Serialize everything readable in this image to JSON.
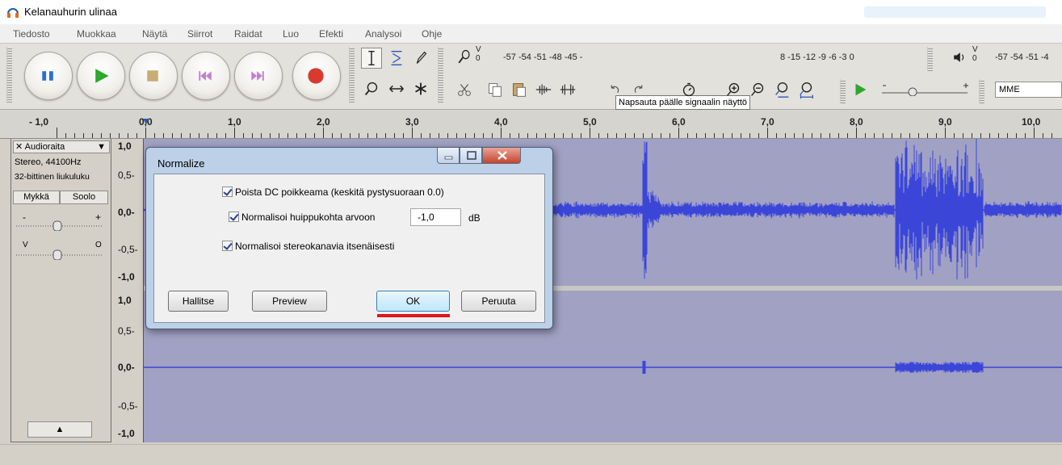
{
  "window": {
    "title": "Kelanauhurin ulinaa"
  },
  "menu": [
    "Tiedosto",
    "Muokkaa",
    "Näytä",
    "Siirrot",
    "Raidat",
    "Luo",
    "Efekti",
    "Analysoi",
    "Ohje"
  ],
  "toolbar": {
    "tooltip": "Napsauta päälle signaalin näyttö",
    "record_meter_scale_left": "-57 -54 -51 -48 -45 -",
    "record_meter_scale_right": "8 -15 -12 -9 -6 -3 0",
    "playback_meter_scale": "-57 -54 -51 -4",
    "meter_label_v": "V",
    "meter_label_0": "0",
    "device": "MME"
  },
  "ruler": {
    "labels": [
      "- 1,0",
      "0,0",
      "1,0",
      "2,0",
      "3,0",
      "4,0",
      "5,0",
      "6,0",
      "7,0",
      "8,0",
      "9,0",
      "10,0"
    ]
  },
  "track": {
    "name": "Audioraita",
    "close_glyph": "✕",
    "menu_glyph": "▼",
    "info_line1": "Stereo, 44100Hz",
    "info_line2": "32-bittinen liukuluku",
    "mute_label": "Mykkä",
    "solo_label": "Soolo",
    "gain_minus": "-",
    "gain_plus": "+",
    "pan_left": "V",
    "pan_right": "O",
    "collapse_glyph": "▲"
  },
  "vruler": {
    "channel1": [
      "1,0",
      "0,5-",
      "0,0-",
      "-0,5-",
      "-1,0"
    ],
    "channel2": [
      "1,0",
      "0,5-",
      "0,0-",
      "-0,5-",
      "-1,0"
    ]
  },
  "dialog": {
    "title": "Normalize",
    "option1": "Poista DC poikkeama (keskitä pystysuoraan 0.0)",
    "option2": "Normalisoi huippukohta arvoon",
    "option2_value": "-1,0",
    "option2_unit": "dB",
    "option3": "Normalisoi stereokanavia itsenäisesti",
    "btn_manage": "Hallitse",
    "btn_preview": "Preview",
    "btn_ok": "OK",
    "btn_cancel": "Peruuta"
  },
  "colors": {
    "waveform": "#3b46d8",
    "track_background": "#a1a1c3",
    "dialog_frame": "#bcd0e8",
    "ok_underline": "#e0141e"
  }
}
